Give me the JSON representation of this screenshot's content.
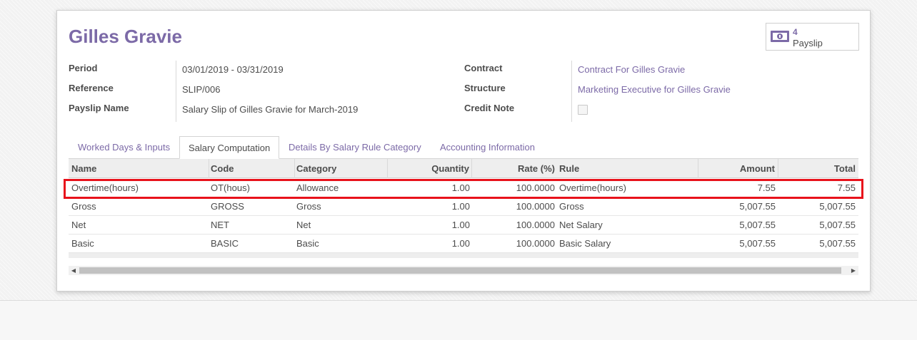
{
  "record": {
    "name": "Gilles Gravie",
    "smart_button": {
      "count": "4",
      "label": "Payslip",
      "icon": "money-icon"
    }
  },
  "fields_left": [
    {
      "label": "Period",
      "value": "03/01/2019 - 03/31/2019"
    },
    {
      "label": "Reference",
      "value": "SLIP/006"
    },
    {
      "label": "Payslip Name",
      "value": "Salary Slip of Gilles Gravie for March-2019"
    }
  ],
  "fields_right": [
    {
      "label": "Contract",
      "value": "Contract For Gilles Gravie"
    },
    {
      "label": "Structure",
      "value": "Marketing Executive for Gilles Gravie"
    },
    {
      "label": "Credit Note",
      "checked": false
    }
  ],
  "tabs": [
    {
      "label": "Worked Days & Inputs",
      "active": false
    },
    {
      "label": "Salary Computation",
      "active": true
    },
    {
      "label": "Details By Salary Rule Category",
      "active": false
    },
    {
      "label": "Accounting Information",
      "active": false
    }
  ],
  "table": {
    "headers": [
      "Name",
      "Code",
      "Category",
      "Quantity",
      "Rate (%)",
      "Rule",
      "Amount",
      "Total"
    ],
    "rows": [
      [
        "Overtime(hours)",
        "OT(hous)",
        "Allowance",
        "1.00",
        "100.0000",
        "Overtime(hours)",
        "7.55",
        "7.55"
      ],
      [
        "Gross",
        "GROSS",
        "Gross",
        "1.00",
        "100.0000",
        "Gross",
        "5,007.55",
        "5,007.55"
      ],
      [
        "Net",
        "NET",
        "Net",
        "1.00",
        "100.0000",
        "Net Salary",
        "5,007.55",
        "5,007.55"
      ],
      [
        "Basic",
        "BASIC",
        "Basic",
        "1.00",
        "100.0000",
        "Basic Salary",
        "5,007.55",
        "5,007.55"
      ]
    ],
    "highlighted_row": 0,
    "highlight_color": "#e8121b"
  },
  "colors": {
    "accent": "#7c6aa7",
    "text": "#4c4c4c"
  }
}
